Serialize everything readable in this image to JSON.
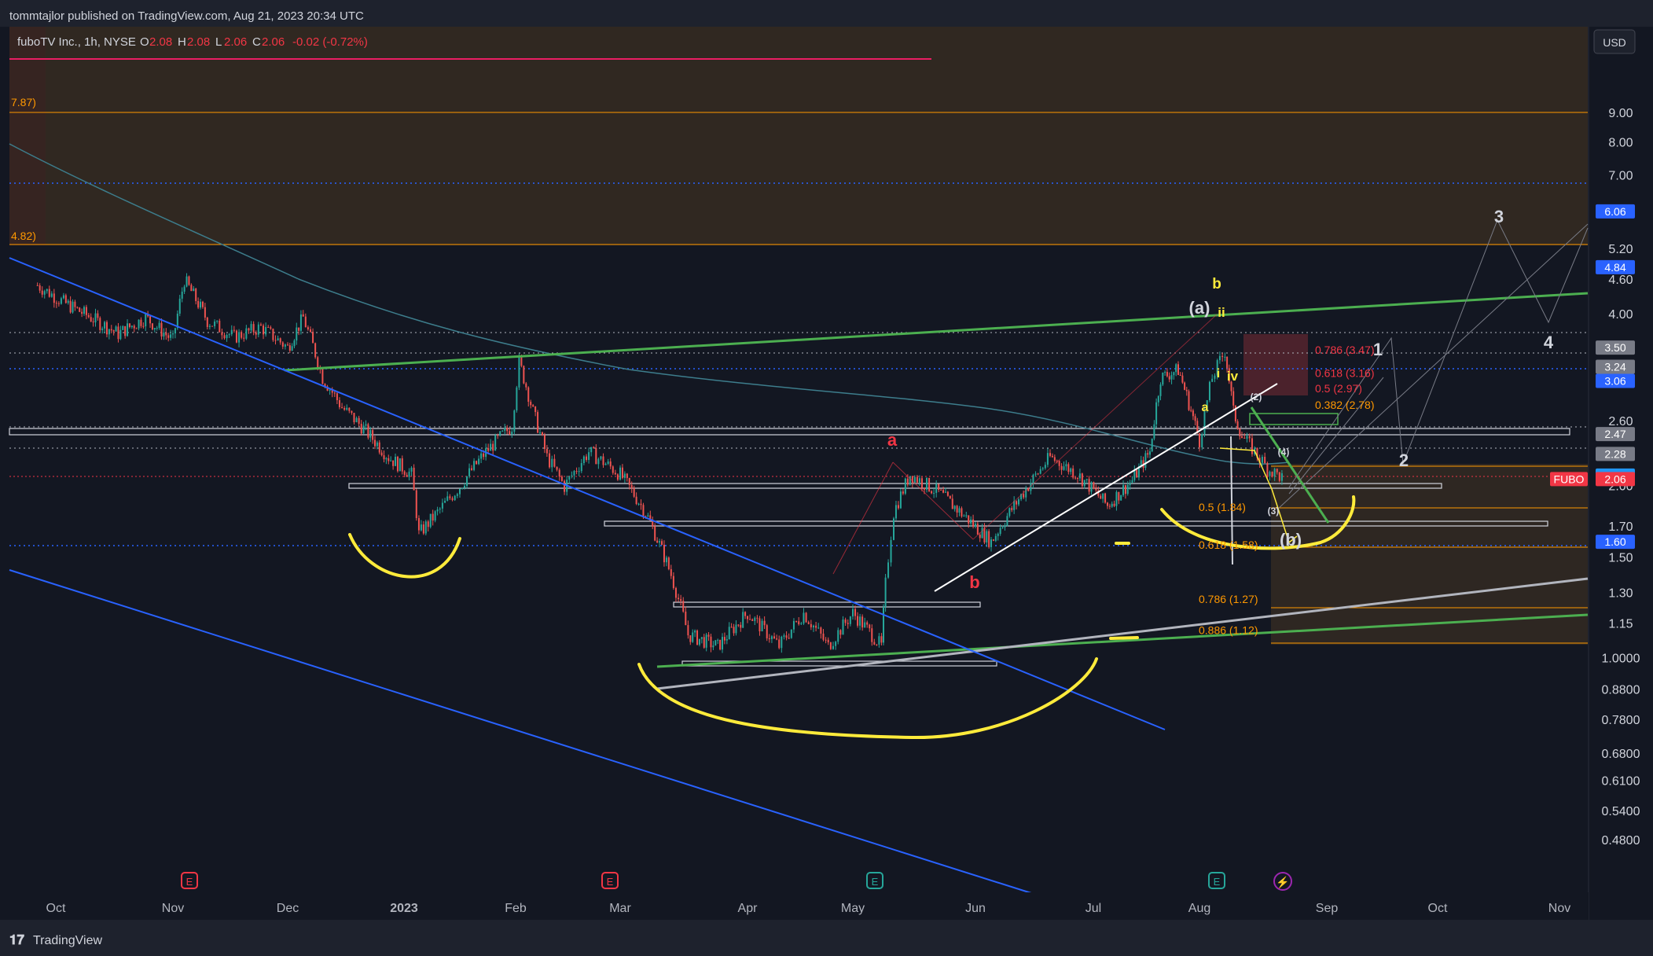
{
  "header": {
    "publisher": "tommtajlor published on TradingView.com, Aug 21, 2023 20:34 UTC",
    "symbol": "fuboTV Inc., 1h, NYSE",
    "o_label": "O",
    "o_value": "2.08",
    "h_label": "H",
    "h_value": "2.08",
    "l_label": "L",
    "l_value": "2.06",
    "c_label": "C",
    "c_value": "2.06",
    "change": "-0.02 (-0.72%)",
    "currency": "USD"
  },
  "footer": {
    "brand": "TradingView"
  },
  "colors": {
    "background": "#131722",
    "axis_text": "#d1d4dc",
    "green_line": "#4caf50",
    "blue_line": "#2962ff",
    "yellow": "#ffeb3b",
    "orange": "#ff9800",
    "red_label": "#f23645",
    "sma": "#3d7d8c",
    "candle_up": "#26a69a",
    "candle_down": "#ef5350"
  },
  "chart_data": {
    "type": "candlestick",
    "title": "fuboTV Inc., 1h, NYSE",
    "log_scale": true,
    "ylim": [
      0.43,
      10.5
    ],
    "y_ticks": [
      "9.00",
      "8.00",
      "7.00",
      "6.00",
      "5.20",
      "4.60",
      "4.00",
      "3.50",
      "3.24",
      "3.06",
      "2.60",
      "2.47",
      "2.28",
      "2.09",
      "2.00",
      "1.70",
      "1.60",
      "1.50",
      "1.30",
      "1.15",
      "1.0000",
      "0.8800",
      "0.7800",
      "0.6800",
      "0.6100",
      "0.5400",
      "0.4800"
    ],
    "x_ticks": [
      "Oct",
      "Nov",
      "Dec",
      "2023",
      "Feb",
      "Mar",
      "Apr",
      "May",
      "Jun",
      "Jul",
      "Aug",
      "Sep",
      "Oct",
      "Nov"
    ],
    "price_tags": [
      {
        "value": "6.06",
        "bg": "#2962ff"
      },
      {
        "value": "4.84",
        "bg": "#2962ff"
      },
      {
        "value": "3.50",
        "bg": "#787b86"
      },
      {
        "value": "3.24",
        "bg": "#787b86"
      },
      {
        "value": "3.06",
        "bg": "#2962ff"
      },
      {
        "value": "2.47",
        "bg": "#787b86"
      },
      {
        "value": "2.28",
        "bg": "#787b86"
      },
      {
        "value": "2.09",
        "bg": "#2196f3"
      },
      {
        "value": "2.06",
        "bg": "#f23645"
      },
      {
        "value": "1.60",
        "bg": "#2962ff"
      }
    ],
    "symbol_tag": "FUBO",
    "left_labels": [
      "7.87)",
      "4.82)"
    ],
    "fib_levels": [
      {
        "label": "0.786 (3.47)",
        "value": 3.47,
        "color": "#f23645"
      },
      {
        "label": "0.618 (3.16)",
        "value": 3.16,
        "color": "#f23645"
      },
      {
        "label": "0.5 (2.97)",
        "value": 2.97,
        "color": "#f23645"
      },
      {
        "label": "0.382 (2.78)",
        "value": 2.78,
        "color": "#ff9800"
      }
    ],
    "fib_levels_lower": [
      {
        "label": "0.5 (1.84)",
        "value": 1.84,
        "color": "#ff9800"
      },
      {
        "label": "0.618 (1.58)",
        "value": 1.58,
        "color": "#ff9800"
      },
      {
        "label": "0.786 (1.27)",
        "value": 1.27,
        "color": "#ff9800"
      },
      {
        "label": "0.886 (1.12)",
        "value": 1.12,
        "color": "#ff9800"
      }
    ],
    "wave_labels": [
      {
        "text": "a",
        "color": "#f23645"
      },
      {
        "text": "b",
        "color": "#f23645"
      },
      {
        "text": "b",
        "color": "#ffeb3b"
      },
      {
        "text": "(a)",
        "color": "#d1d4dc"
      },
      {
        "text": "ii",
        "color": "#ffeb3b"
      },
      {
        "text": "i",
        "color": "#ffeb3b"
      },
      {
        "text": "iv",
        "color": "#ffeb3b"
      },
      {
        "text": "a",
        "color": "#ffeb3b"
      },
      {
        "text": "(b)",
        "color": "#d1d4dc"
      },
      {
        "text": "(2)",
        "color": "#d1d4dc"
      },
      {
        "text": "(3)",
        "color": "#d1d4dc"
      },
      {
        "text": "(4)",
        "color": "#d1d4dc"
      },
      {
        "text": "1",
        "color": "#d1d4dc"
      },
      {
        "text": "2",
        "color": "#d1d4dc"
      },
      {
        "text": "3",
        "color": "#d1d4dc"
      },
      {
        "text": "4",
        "color": "#d1d4dc"
      }
    ],
    "price_path": [
      [
        "Sep 26",
        4.5
      ],
      [
        "Oct 3",
        4.2
      ],
      [
        "Oct 10",
        3.95
      ],
      [
        "Oct 17",
        3.7
      ],
      [
        "Oct 24",
        3.95
      ],
      [
        "Oct 31",
        3.6
      ],
      [
        "Nov 4",
        4.6
      ],
      [
        "Nov 10",
        3.9
      ],
      [
        "Nov 17",
        3.65
      ],
      [
        "Nov 24",
        3.8
      ],
      [
        "Dec 1",
        3.5
      ],
      [
        "Dec 5",
        3.95
      ],
      [
        "Dec 10",
        3.1
      ],
      [
        "Dec 15",
        2.75
      ],
      [
        "Dec 20",
        2.55
      ],
      [
        "Dec 27",
        2.25
      ],
      [
        "Jan 3",
        2.1
      ],
      [
        "Jan 5",
        1.65
      ],
      [
        "Jan 10",
        1.8
      ],
      [
        "Jan 16",
        2.0
      ],
      [
        "Jan 23",
        2.3
      ],
      [
        "Jan 30",
        2.55
      ],
      [
        "Feb 2",
        3.3
      ],
      [
        "Feb 6",
        2.7
      ],
      [
        "Feb 10",
        2.25
      ],
      [
        "Feb 15",
        2.0
      ],
      [
        "Feb 22",
        2.3
      ],
      [
        "Mar 1",
        2.1
      ],
      [
        "Mar 7",
        1.8
      ],
      [
        "Mar 13",
        1.4
      ],
      [
        "Mar 17",
        1.1
      ],
      [
        "Mar 24",
        1.05
      ],
      [
        "Apr 1",
        1.2
      ],
      [
        "Apr 10",
        1.05
      ],
      [
        "Apr 17",
        1.2
      ],
      [
        "Apr 24",
        1.05
      ],
      [
        "May 1",
        1.2
      ],
      [
        "May 8",
        1.05
      ],
      [
        "May 9",
        1.35
      ],
      [
        "May 11",
        1.8
      ],
      [
        "May 15",
        2.1
      ],
      [
        "May 22",
        1.95
      ],
      [
        "Jun 1",
        1.7
      ],
      [
        "Jun 5",
        1.6
      ],
      [
        "Jun 12",
        1.9
      ],
      [
        "Jun 20",
        2.25
      ],
      [
        "Jun 27",
        2.1
      ],
      [
        "Jul 5",
        1.85
      ],
      [
        "Jul 12",
        2.05
      ],
      [
        "Jul 17",
        2.3
      ],
      [
        "Jul 20",
        3.1
      ],
      [
        "Jul 25",
        3.2
      ],
      [
        "Jul 28",
        2.8
      ],
      [
        "Aug 1",
        2.4
      ],
      [
        "Aug 4",
        3.1
      ],
      [
        "Aug 7",
        3.45
      ],
      [
        "Aug 9",
        2.7
      ],
      [
        "Aug 11",
        2.45
      ],
      [
        "Aug 14",
        2.3
      ],
      [
        "Aug 17",
        2.15
      ],
      [
        "Aug 21",
        2.06
      ]
    ]
  }
}
